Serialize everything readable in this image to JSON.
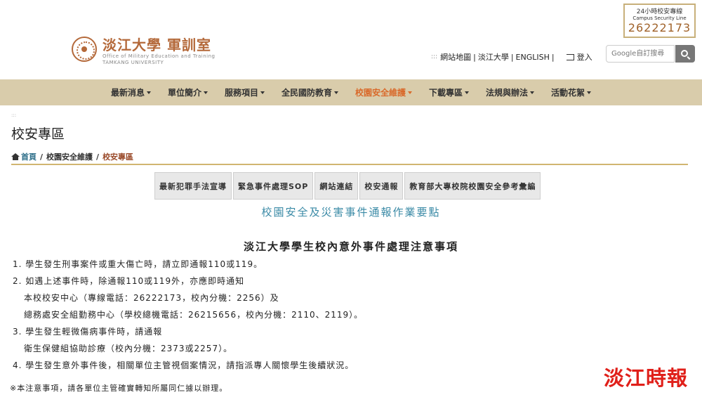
{
  "header": {
    "logo_cn": "淡江大學 軍訓室",
    "logo_en_1": "Office of Military Education and Training",
    "logo_en_2": "TAMKANG UNIVERSITY",
    "hotline_label_cn": "24小時校安專線",
    "hotline_label_en": "Campus Security Line",
    "hotline_number": "26222173",
    "toplinks": {
      "dots": ":::",
      "sitemap": "網站地圖",
      "tku": "淡江大學",
      "english": "ENGLISH",
      "sep": "|",
      "login": "登入"
    },
    "search_placeholder": "Google自訂搜尋"
  },
  "nav": {
    "items": [
      "最新消息",
      "單位簡介",
      "服務項目",
      "全民國防教育",
      "校園安全維護",
      "下載專區",
      "法規與辦法",
      "活動花絮"
    ],
    "active_index": 4,
    "active_color": "#d96a2b",
    "background": "#d9ccab"
  },
  "page": {
    "dots": ":::",
    "title": "校安專區",
    "breadcrumb": {
      "home": "首頁",
      "sep": "/",
      "parent": "校園安全維護",
      "current": "校安專區"
    }
  },
  "tabs": [
    "最新犯罪手法宣導",
    "緊急事件處理SOP",
    "網站連結",
    "校安通報",
    "教育部大專校院校園安全參考彙編"
  ],
  "content": {
    "subheading": "校園安全及災害事件通報作業要點",
    "notice_title": "淡江大學學生校內意外事件處理注意事項",
    "lines": [
      "1. 學生發生刑事案件或重大傷亡時，請立即通報110或119。",
      "2. 如遇上述事件時，除通報110或119外，亦應即時通知",
      "本校校安中心（專線電話：26222173，校內分機：2256）及",
      "總務處安全組勤務中心（學校總機電話：26215656，校內分機：2110、2119）。",
      "3. 學生發生輕微傷病事件時，請通報",
      "衛生保健組協助診療（校內分機：2373或2257）。",
      "4. 學生發生意外事件後，相關單位主管視個案情況，請指派專人關懷學生後續狀況。"
    ],
    "footer_note": "※本注意事項，請各單位主管確實轉知所屬同仁據以辦理。"
  },
  "watermark": "淡江時報"
}
